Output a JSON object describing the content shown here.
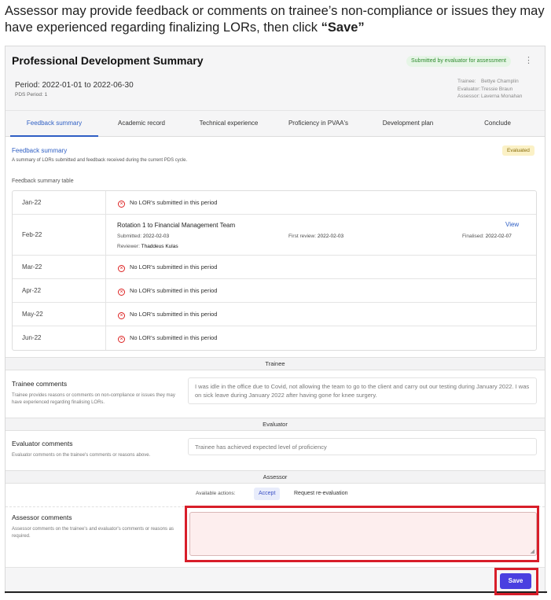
{
  "instruction": {
    "text": "Assessor may provide feedback or comments on trainee’s non-compliance or issues they may have experienced regarding finalizing LORs, then click ",
    "emphasis": "“Save”"
  },
  "header": {
    "title": "Professional Development Summary",
    "status": "Submitted by evaluator for assessment",
    "menu_icon": "more-vertical-icon",
    "period": "Period: 2022-01-01 to 2022-06-30",
    "pds_period": "PDS Period: 1",
    "trainee_label": "Trainee:",
    "trainee": "Bettye Champlin",
    "evaluator_label": "Evaluator:",
    "evaluator": "Tressie Braun",
    "assessor_label": "Assessor:",
    "assessor": "Laverna Monahan"
  },
  "tabs": [
    {
      "label": "Feedback summary",
      "active": true
    },
    {
      "label": "Academic record",
      "active": false
    },
    {
      "label": "Technical experience",
      "active": false
    },
    {
      "label": "Proficiency in PVAA's",
      "active": false
    },
    {
      "label": "Development plan",
      "active": false
    },
    {
      "label": "Conclude",
      "active": false
    }
  ],
  "feedback": {
    "title": "Feedback summary",
    "description": "A summary of LORs submitted and feedback received during the current PDS cycle.",
    "badge": "Evaluated",
    "table_label": "Feedback summary table",
    "no_lor_text": "No LOR's submitted in this period",
    "rows": [
      {
        "month": "Jan-22"
      },
      {
        "month": "Feb-22",
        "title": "Rotation 1 to Financial Management Team",
        "view": "View",
        "submitted_label": "Submitted:",
        "submitted": "2022-02-03",
        "reviewer_label": "Reviewer:",
        "reviewer": "Thaddeus Kulas",
        "first_review_label": "First review:",
        "first_review": "2022-02-03",
        "finalised_label": "Finalised:",
        "finalised": "2022-02-07"
      },
      {
        "month": "Mar-22"
      },
      {
        "month": "Apr-22"
      },
      {
        "month": "May-22"
      },
      {
        "month": "Jun-22"
      }
    ]
  },
  "trainee_section": {
    "header": "Trainee",
    "title": "Trainee comments",
    "description": "Trainee provides reasons or comments on non-compliance or issues they may have experienced regarding finalising LORs.",
    "comment": "I was idle in the office due to Covid, not allowing the team to go to the client and carry out our testing during January 2022. I was on sick leave during January 2022 after having gone for knee surgery."
  },
  "evaluator_section": {
    "header": "Evaluator",
    "title": "Evaluator comments",
    "description": "Evaluator comments on the trainee's comments or reasons above.",
    "comment": "Trainee has achieved expected level of proficiency"
  },
  "assessor_section": {
    "header": "Assessor",
    "available_actions": "Available actions:",
    "accept": "Accept",
    "re_evaluate": "Request re-evaluation",
    "title": "Assessor comments",
    "description": "Assessor comments on the trainee's and evaluator's comments or reasons as required.",
    "comment": ""
  },
  "footer": {
    "save": "Save"
  },
  "colors": {
    "accent": "#2f5fc4",
    "save_button": "#4a3fe0",
    "highlight_frame": "#d81e2a",
    "error_icon": "#dd2222"
  }
}
